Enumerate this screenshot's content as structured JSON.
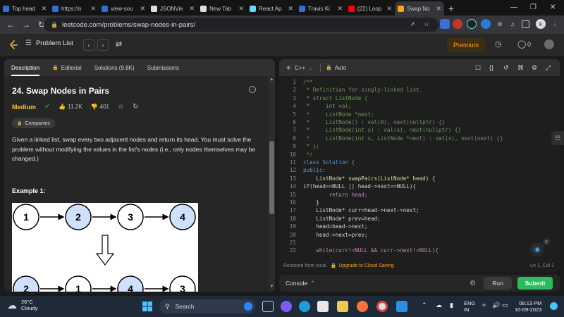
{
  "browser": {
    "tabs": [
      {
        "title": "Top head",
        "fav": "#2f6fd6"
      },
      {
        "title": "https://n",
        "fav": "#2f6fd6"
      },
      {
        "title": "view-sou",
        "fav": "#2f6fd6"
      },
      {
        "title": "JSONVie",
        "fav": "#dddddd"
      },
      {
        "title": "New Tab",
        "fav": "#e0e0e0"
      },
      {
        "title": "React Ap",
        "fav": "#61dafb"
      },
      {
        "title": "Travis Ki",
        "fav": "#2f6fd6"
      },
      {
        "title": "(22) Loop",
        "fav": "#ff0000"
      },
      {
        "title": "Swap No",
        "fav": "#ffa116"
      }
    ],
    "url": "leetcode.com/problems/swap-nodes-in-pairs/"
  },
  "header": {
    "problem_list": "Problem List",
    "premium": "Premium",
    "streak": "0"
  },
  "left": {
    "tabs": [
      "Description",
      "Editorial",
      "Solutions (9.8K)",
      "Submissions"
    ],
    "title": "24. Swap Nodes in Pairs",
    "difficulty": "Medium",
    "likes": "11.2K",
    "dislikes": "401",
    "companies": "Companies",
    "description": "Given a linked list, swap every two adjacent nodes and return its head. You must solve the problem without modifying the values in the list's nodes (i.e., only nodes themselves may be changed.)",
    "example_title": "Example 1:",
    "top_nodes": [
      "1",
      "2",
      "3",
      "4"
    ],
    "bottom_nodes": [
      "2",
      "1",
      "4",
      "3"
    ]
  },
  "editor": {
    "language": "C++",
    "mode": "Auto",
    "lines": [
      {
        "n": "1",
        "t": "/**",
        "c": "#6a9955"
      },
      {
        "n": "2",
        "t": " * Definition for singly-linked list.",
        "c": "#6a9955"
      },
      {
        "n": "3",
        "t": " * struct ListNode {",
        "c": "#6a9955"
      },
      {
        "n": "4",
        "t": " *     int val;",
        "c": "#6a9955"
      },
      {
        "n": "5",
        "t": " *     ListNode *next;",
        "c": "#6a9955"
      },
      {
        "n": "6",
        "t": " *     ListNode() : val(0), next(nullptr) {}",
        "c": "#6a9955"
      },
      {
        "n": "7",
        "t": " *     ListNode(int x) : val(x), next(nullptr) {}",
        "c": "#6a9955"
      },
      {
        "n": "8",
        "t": " *     ListNode(int x, ListNode *next) : val(x), next(next) {}",
        "c": "#6a9955"
      },
      {
        "n": "9",
        "t": " * };",
        "c": "#6a9955"
      },
      {
        "n": "10",
        "t": " */",
        "c": "#6a9955"
      },
      {
        "n": "11",
        "t": "class Solution {",
        "c": "#569cd6"
      },
      {
        "n": "12",
        "t": "public:",
        "c": "#569cd6"
      },
      {
        "n": "13",
        "t": "    ListNode* swapPairs(ListNode* head) {",
        "c": "#dcdcaa"
      },
      {
        "n": "14",
        "t": "if(head==NULL || head->next==NULL){",
        "c": "#d4d4d4"
      },
      {
        "n": "15",
        "t": "        return head;",
        "c": "#c586c0"
      },
      {
        "n": "16",
        "t": "    }",
        "c": "#d4d4d4"
      },
      {
        "n": "17",
        "t": "    ListNode* curr=head->next->next;",
        "c": "#d4d4d4"
      },
      {
        "n": "18",
        "t": "    ListNode* prev=head;",
        "c": "#d4d4d4"
      },
      {
        "n": "19",
        "t": "    head=head->next;",
        "c": "#d4d4d4"
      },
      {
        "n": "20",
        "t": "    head->next=prev;",
        "c": "#d4d4d4"
      },
      {
        "n": "21",
        "t": "",
        "c": "#d4d4d4"
      },
      {
        "n": "22",
        "t": "    while(curr!=NULL && curr->next!=NULL){",
        "c": "#c586c0"
      }
    ],
    "status_left": "Restored from local",
    "upgrade": "Upgrade to Cloud Saving",
    "cursor": "Ln 1, Col 1"
  },
  "console": {
    "label": "Console",
    "run": "Run",
    "submit": "Submit"
  },
  "taskbar": {
    "temp": "26°C",
    "weather": "Cloudy",
    "search": "Search",
    "lang1": "ENG",
    "lang2": "IN",
    "time": "08:13 PM",
    "date": "10-09-2023"
  }
}
